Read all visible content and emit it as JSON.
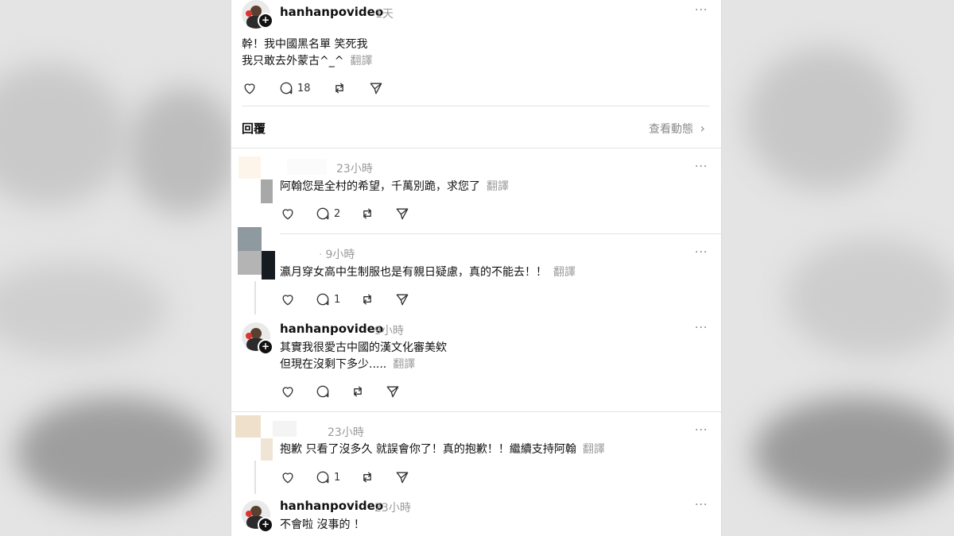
{
  "post": {
    "username": "hanhanpovideo",
    "time": "1天",
    "line1": "幹！我中國黑名單 笑死我",
    "line2": "我只敢去外蒙古^_^",
    "translate": "翻譯",
    "reply_count": "18"
  },
  "replies_header": {
    "title": "回覆",
    "view_activity": "查看動態"
  },
  "comments": [
    {
      "time": "23小時",
      "text": "阿翰您是全村的希望，千萬別跪，求您了",
      "translate": "翻譯",
      "reply_count": "2"
    },
    {
      "time": "9小時",
      "text": "瀛月穿女高中生制服也是有親日疑慮，真的不能去！！",
      "translate": "翻譯",
      "reply_count": "1"
    },
    {
      "username": "hanhanpovideo",
      "time": "9小時",
      "line1": "其實我很愛古中國的漢文化審美欸",
      "line2": "但現在沒剩下多少.....",
      "translate": "翻譯"
    },
    {
      "time": "23小時",
      "text": "抱歉 只看了沒多久 就誤會你了！真的抱歉！！繼續支持阿翰",
      "translate": "翻譯",
      "reply_count": "1"
    },
    {
      "username": "hanhanpovideo",
      "time": "23小時",
      "text": "不會啦 沒事的 ！"
    }
  ],
  "icons": {
    "like": "heart-icon",
    "comment": "comment-icon",
    "repost": "repost-icon",
    "share": "send-icon",
    "more": "more-icon",
    "chevron": "chevron-right-icon"
  },
  "more_glyph": "···",
  "plus_glyph": "+",
  "chevron_glyph": "›"
}
